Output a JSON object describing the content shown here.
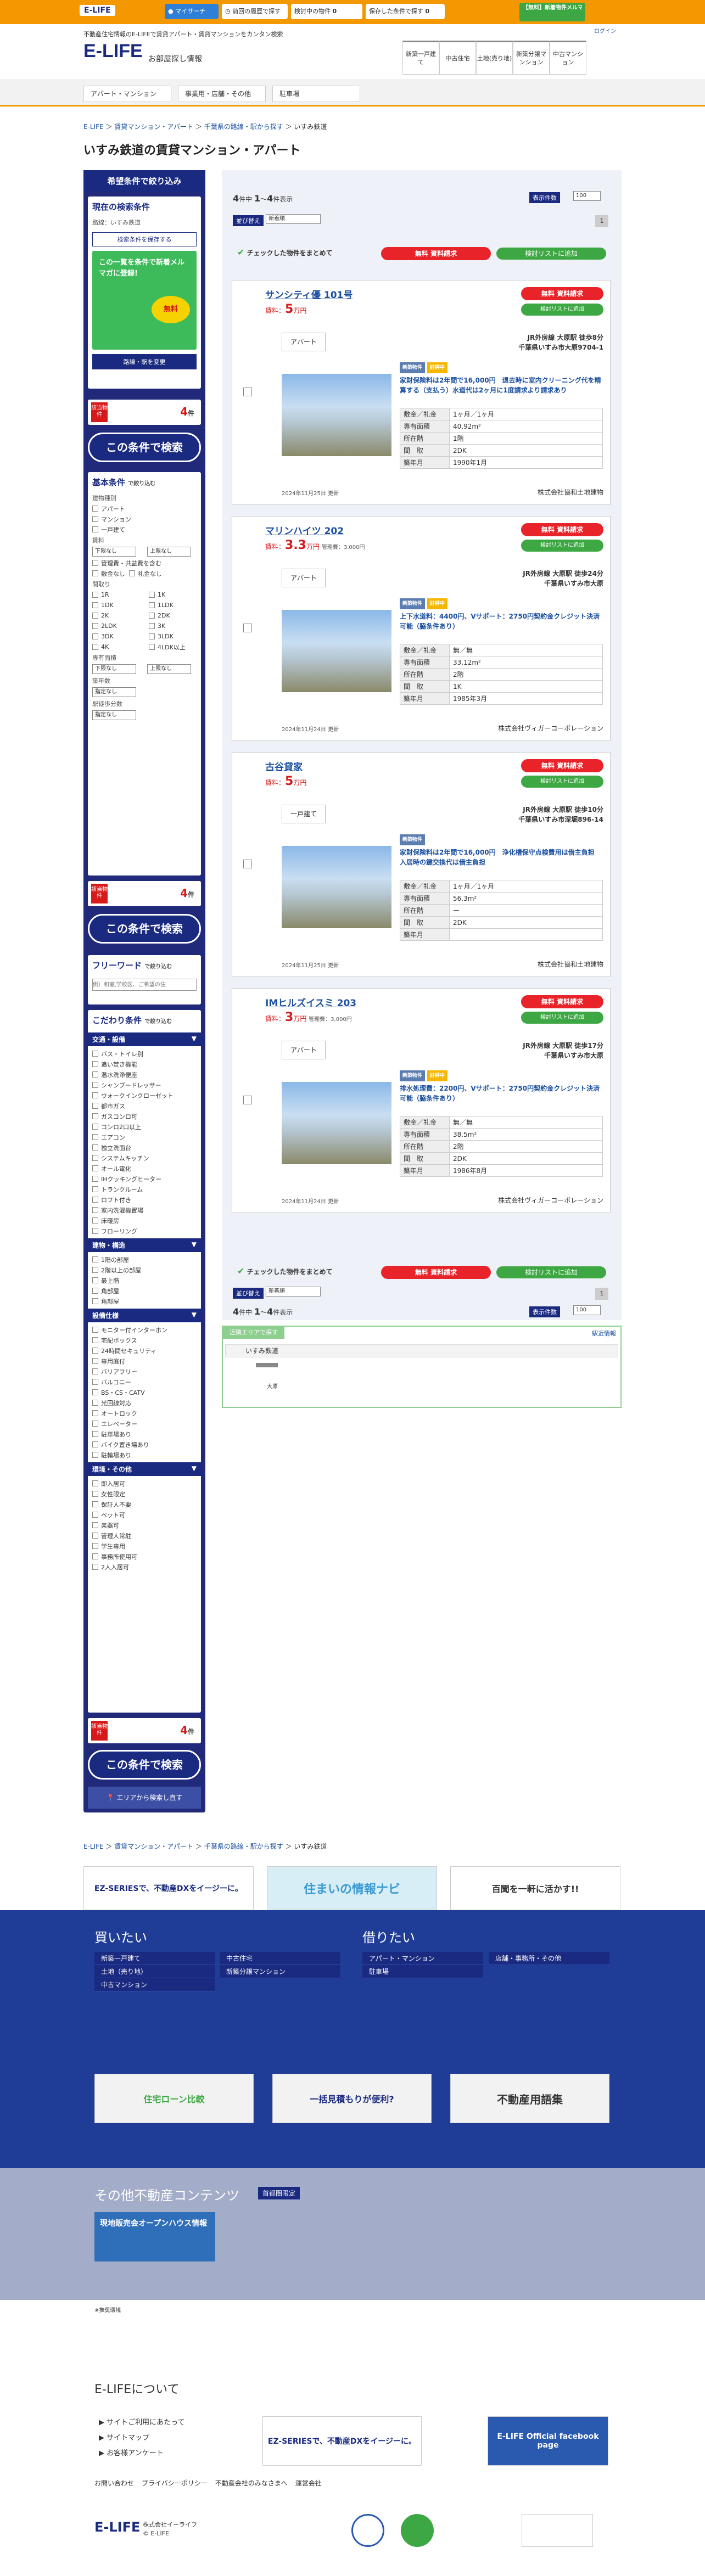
{
  "topbar": {
    "logo": "E-LIFE",
    "mysearch": "マイサーチ",
    "history": "前回の履歴で探す",
    "viewed": "検討中の物件",
    "viewed_count": "0",
    "saved": "保存した条件で探す",
    "saved_count": "0",
    "register": "【無料】新着物件メルマガ登録",
    "register_line2": "メルマガ登録",
    "login": "ログイン"
  },
  "header": {
    "tagline": "不動産住宅情報のE-LIFEで賃貸アパート・賃貸マンションをカンタン検索",
    "logo": "E-LIFE",
    "logo_sub": "お部屋探し情報",
    "cats": [
      "新築一戸建て",
      "中古住宅",
      "土地(売り地)",
      "新築分譲マンション",
      "中古マンション"
    ]
  },
  "subnav": [
    "アパート・マンション",
    "事業用・店舗・その他",
    "駐車場"
  ],
  "breadcrumb": {
    "items": [
      "E-LIFE",
      "賃貸マンション・アパート",
      "千葉県の路線・駅から探す",
      "いすみ鉄道"
    ],
    "sep": "＞"
  },
  "page_title": "いすみ鉄道の賃貸マンション・アパート",
  "sidebar": {
    "head": "希望条件で絞り込み",
    "current_title": "現在の検索条件",
    "route_label": "路線：いすみ鉄道",
    "save_cond": "検索条件を保存する",
    "mail_banner": "この一覧を条件で新着メルマガに登録!",
    "mail_sub": "無料",
    "change_btn": "路線・駅を変更",
    "hit_label": "該当物件",
    "hit_count": "4",
    "hit_unit": "件",
    "search_btn": "この条件で検索",
    "basic_title": "基本条件",
    "basic_sub": "で絞り込む",
    "type_label": "建物種別",
    "types": [
      "アパート",
      "マンション",
      "一戸建て"
    ],
    "rent_label": "賃料",
    "rent_min": "下限なし",
    "rent_max": "上限なし",
    "rent_opts": [
      "管理費・共益費を含む",
      "敷金なし",
      "礼金なし"
    ],
    "layout_label": "間取り",
    "layouts": [
      "1R",
      "1K",
      "1DK",
      "1LDK",
      "2K",
      "2DK",
      "2LDK",
      "3K",
      "3DK",
      "3LDK",
      "4K",
      "4LDK以上"
    ],
    "area_label": "専有面積",
    "area_min": "下限なし",
    "area_max": "上限なし",
    "age_label": "築年数",
    "age_val": "指定なし",
    "walk_label": "駅徒歩分数",
    "walk_val": "指定なし",
    "freeword_title": "フリーワード",
    "freeword_sub": "で絞り込む",
    "freeword_ph": "例）和室,学校区、ご希望の住",
    "kodawari_title": "こだわり条件",
    "kodawari_sub": "で絞り込む",
    "groups": [
      {
        "name": "交通・設備",
        "items": [
          "バス・トイレ別",
          "追い焚き機能",
          "温水洗浄便座",
          "シャンプードレッサー",
          "ウォークインクローゼット",
          "都市ガス",
          "ガスコンロ可",
          "コンロ2口以上",
          "エアコン",
          "独立洗面台",
          "システムキッチン",
          "オール電化",
          "IHクッキングヒーター",
          "トランクルーム",
          "ロフト付き",
          "室内洗濯機置場",
          "床暖房",
          "フローリング"
        ]
      },
      {
        "name": "建物・構造",
        "items": [
          "1階の部屋",
          "2階以上の部屋",
          "最上階",
          "角部屋",
          "角部屋"
        ]
      },
      {
        "name": "設備仕様",
        "items": [
          "モニター付インターホン",
          "宅配ボックス",
          "24時間セキュリティ",
          "専用庭付",
          "バリアフリー",
          "バルコニー",
          "BS・CS・CATV",
          "光回線対応",
          "オートロック",
          "エレベーター",
          "駐車場あり",
          "バイク置き場あり",
          "駐輪場あり"
        ]
      },
      {
        "name": "環境・その他",
        "items": [
          "即入居可",
          "女性限定",
          "保証人不要",
          "ペット可",
          "楽器可",
          "管理人常駐",
          "学生専用",
          "事務所使用可",
          "2人入居可"
        ]
      }
    ],
    "area_search": "エリアから検索し直す"
  },
  "results": {
    "count_pre": "4",
    "count_pre_label": "件中",
    "from": "1",
    "to": "4",
    "range_label": "件表示",
    "display_count_label": "表示件数",
    "display_count": "100",
    "sort_label": "並び替え",
    "sort_val": "新着順",
    "page": "1",
    "bulk_check": "チェックした物件をまとめて",
    "free": "無料",
    "request_btn": "資料請求",
    "add_list": "検討リストに追加"
  },
  "properties": [
    {
      "name": "サンシティ優 101号",
      "rent": "5",
      "rent_unit": "万円",
      "mgmt": "",
      "type": "アパート",
      "access": "JR外房線 大原駅 徒歩8分",
      "address": "千葉県いすみ市大原9704-1",
      "tags": [
        "新築物件",
        "好評中"
      ],
      "feature": "家財保険料は2年間で16,000円　退去時に室内クリーニング代を精算する（支払う）水道代は2ヶ月に1度請求より請求あり",
      "deposit": "1ヶ月／1ヶ月",
      "area": "40.92m²",
      "floor": "1階",
      "layout": "2DK",
      "built": "1990年1月",
      "date": "2024年11月25日 更新",
      "agent": "株式会社協和土地建物"
    },
    {
      "name": "マリンハイツ 202",
      "rent": "3.3",
      "rent_unit": "万円",
      "mgmt": "管理費：3,000円",
      "type": "アパート",
      "access": "JR外房線 大原駅 徒歩24分",
      "address": "千葉県いすみ市大原",
      "tags": [
        "新築物件",
        "好評中"
      ],
      "feature": "上下水道料：4400円、Vサポート：2750円契約金クレジット決済可能（脇条件あり）",
      "deposit": "無／無",
      "area": "33.12m²",
      "floor": "2階",
      "layout": "1K",
      "built": "1985年3月",
      "date": "2024年11月24日 更新",
      "agent": "株式会社ヴィガーコーポレーション"
    },
    {
      "name": "古谷貸家",
      "rent": "5",
      "rent_unit": "万円",
      "mgmt": "",
      "type": "一戸建て",
      "access": "JR外房線 大原駅 徒歩10分",
      "address": "千葉県いすみ市深堀896-14",
      "tags": [
        "新築物件"
      ],
      "feature": "家財保険料は2年間で16,000円　浄化槽保守点検費用は借主負担　入居時の鍵交換代は借主負担",
      "deposit": "1ヶ月／1ヶ月",
      "area": "56.3m²",
      "floor": "ー",
      "layout": "2DK",
      "built": "",
      "date": "2024年11月25日 更新",
      "agent": "株式会社協和土地建物"
    },
    {
      "name": "IMヒルズイスミ 203",
      "rent": "3",
      "rent_unit": "万円",
      "mgmt": "管理費：3,000円",
      "type": "アパート",
      "access": "JR外房線 大原駅 徒歩17分",
      "address": "千葉県いすみ市大原",
      "tags": [
        "新築物件",
        "好評中"
      ],
      "feature": "排水処理費：2200円、Vサポート：2750円契約金クレジット決済可能（脇条件あり）",
      "deposit": "無／無",
      "area": "38.5m²",
      "floor": "2階",
      "layout": "2DK",
      "built": "1986年8月",
      "date": "2024年11月24日 更新",
      "agent": "株式会社ヴィガーコーポレーション"
    }
  ],
  "table_keys": [
    "敷金／礼金",
    "専有面積",
    "所在階",
    "間　取",
    "築年月"
  ],
  "nearby": {
    "tab": "近隣エリアで探す",
    "link": "駅近情報",
    "line": "いすみ鉄道",
    "station": "大原"
  },
  "banners": [
    "EZ-SERIESで、不動産DXをイージーに。",
    "住まいの情報ナビ",
    "百聞を一軒に活かす!!"
  ],
  "footer": {
    "buy_title": "買いたい",
    "buy": [
      "新築一戸建て",
      "中古住宅",
      "土地（売り地）",
      "新築分譲マンション",
      "中古マンション"
    ],
    "rent_title": "借りたい",
    "rent": [
      "アパート・マンション",
      "店舗・事務所・その他",
      "駐車場"
    ],
    "promo": [
      "住宅ローン比較",
      "一括見積もりが便利?",
      "不動産用語集"
    ],
    "other_title": "その他不動産コンテンツ",
    "other_sub": "首都圏限定",
    "openhouse": "現地販売会オープンハウス情報",
    "notes": "※推奨環境",
    "about_title": "E-LIFEについて",
    "about": [
      "サイトご利用にあたって",
      "サイトマップ",
      "お客様アンケート"
    ],
    "links": [
      "お問い合わせ",
      "プライバシーポリシー",
      "不動産会社のみなさまへ",
      "運営会社"
    ],
    "company": "株式会社イーライフ",
    "copyright": "© E-LIFE",
    "fb": "E-LIFE Official facebook page"
  },
  "colors": {
    "orange": "#f39800",
    "navy": "#1a2a80",
    "red": "#e8232a",
    "green": "#3da843"
  }
}
